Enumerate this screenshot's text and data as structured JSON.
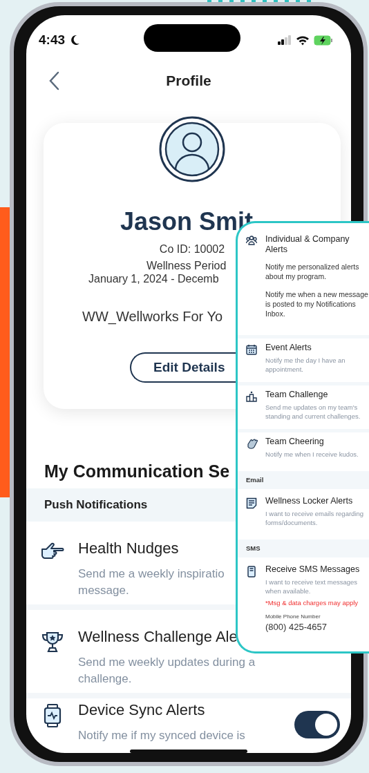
{
  "status_bar": {
    "time": "4:43"
  },
  "header": {
    "title": "Profile"
  },
  "profile": {
    "name": "Jason Smit",
    "co_id": "Co ID: 10002",
    "period_label": "Wellness Period",
    "period_dates": "January 1, 2024 - Decemb",
    "program": "WW_Wellworks For Yo",
    "edit_button": "Edit Details"
  },
  "section_title": "My Communication Se",
  "push_header": "Push Notifications",
  "settings": [
    {
      "title": "Health Nudges",
      "description": [
        "Send me a weekly inspiratio",
        "message."
      ]
    },
    {
      "title": "Wellness Challenge Ale",
      "description": [
        "Send me weekly updates during a",
        "challenge."
      ]
    },
    {
      "title": "Device Sync Alerts",
      "description": [
        "Notify me if my synced device is"
      ],
      "on": true
    }
  ],
  "overlay": {
    "items": [
      {
        "kind": "setting",
        "title": "Individual & Company Alerts",
        "description": [
          "Notify me personalized alerts about my program.",
          "Notify me when a new message is posted to my Notifications Inbox."
        ]
      },
      {
        "kind": "setting",
        "title": "Event Alerts",
        "description": [
          "Notify me the day I have an appointment."
        ]
      },
      {
        "kind": "setting",
        "title": "Team Challenge",
        "description": [
          "Send me updates on my team's standing and current challenges."
        ]
      },
      {
        "kind": "setting",
        "title": "Team Cheering",
        "description": [
          "Notify me when I receive kudos."
        ]
      },
      {
        "kind": "section",
        "title": "Email"
      },
      {
        "kind": "setting",
        "title": "Wellness Locker Alerts",
        "description": [
          "I want to receive emails regarding forms/documents."
        ]
      },
      {
        "kind": "section",
        "title": "SMS"
      },
      {
        "kind": "setting",
        "title": "Receive SMS Messages",
        "description": [
          "I want to receive text messages when available."
        ],
        "note": "*Msg & data charges may apply",
        "field_label": "Mobile Phone Number",
        "field_value": "(800) 425-4657"
      }
    ]
  }
}
